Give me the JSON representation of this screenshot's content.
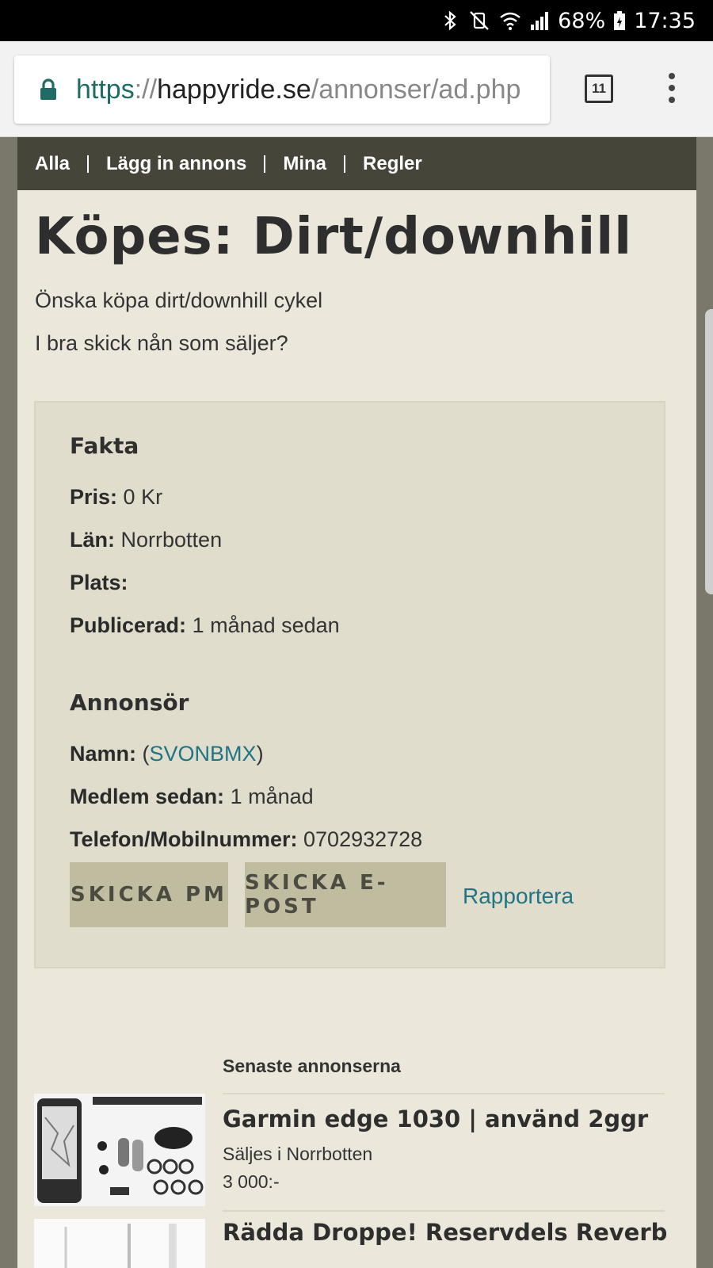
{
  "status_bar": {
    "battery": "68%",
    "time": "17:35"
  },
  "browser": {
    "url_scheme": "https",
    "url_separator": "://",
    "url_host": "happyride.se",
    "url_path": "/annonser/ad.php",
    "tab_count": "11"
  },
  "nav": {
    "items": [
      "Alla",
      "Lägg in annons",
      "Mina",
      "Regler"
    ]
  },
  "ad": {
    "title": "Köpes: Dirt/downhill",
    "description_lines": [
      "Önska köpa dirt/downhill cykel",
      "I bra skick nån som säljer?"
    ]
  },
  "facts": {
    "heading": "Fakta",
    "price_label": "Pris:",
    "price_value": "0 Kr",
    "county_label": "Län:",
    "county_value": "Norrbotten",
    "place_label": "Plats:",
    "place_value": "",
    "published_label": "Publicerad:",
    "published_value": "1 månad sedan"
  },
  "advertiser": {
    "heading": "Annonsör",
    "name_label": "Namn:",
    "name_open": "(",
    "name_value": "SVONBMX",
    "name_close": ")",
    "member_label": "Medlem sedan:",
    "member_value": "1 månad",
    "phone_label": "Telefon/Mobilnummer:",
    "phone_value": "0702932728"
  },
  "actions": {
    "pm_button": "SKICKA PM",
    "email_button": "SKICKA E-POST",
    "report_link": "Rapportera"
  },
  "latest": {
    "heading": "Senaste annonserna",
    "items": [
      {
        "title": "Garmin edge 1030 | använd 2ggr",
        "location": "Säljes i Norrbotten",
        "price": "3 000:-"
      },
      {
        "title": "Rädda Droppe! Reservdels Reverb",
        "location": "",
        "price": ""
      }
    ]
  }
}
